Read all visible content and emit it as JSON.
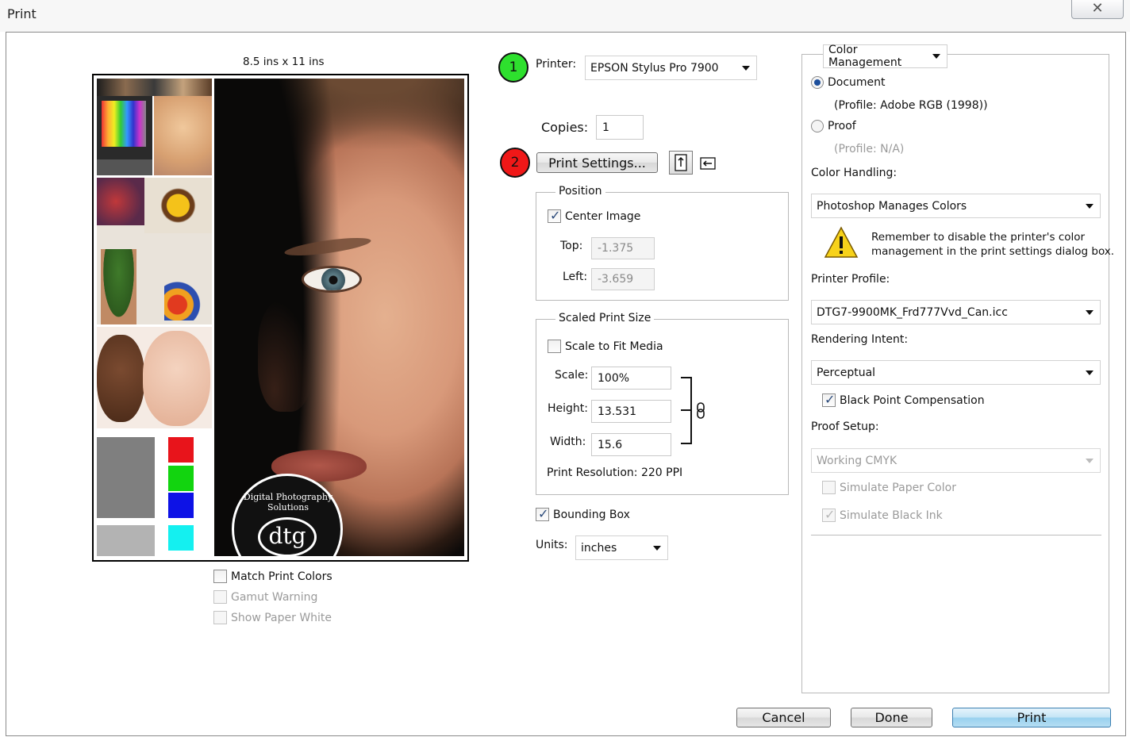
{
  "window": {
    "title": "Print",
    "close_glyph": "✕"
  },
  "preview": {
    "paper_size": "8.5 ins x 11 ins",
    "logo_text": "Digital Photography Solutions",
    "logo_mark": "dtg",
    "swatch_colors": [
      "#7f7f7f",
      "#e8141b",
      "#12d40f",
      "#0d12e6",
      "#b3b3b3",
      "#14f0f0"
    ],
    "match_print_colors": "Match Print Colors",
    "gamut_warning": "Gamut Warning",
    "show_paper_white": "Show Paper White"
  },
  "badges": {
    "one": "1",
    "two": "2",
    "one_color": "#2ee02e",
    "two_color": "#f01818"
  },
  "printer": {
    "label": "Printer:",
    "value": "EPSON Stylus Pro 7900"
  },
  "copies": {
    "label": "Copies:",
    "value": "1"
  },
  "print_settings_button": "Print Settings...",
  "position": {
    "title": "Position",
    "center_image": "Center Image",
    "top_label": "Top:",
    "top_value": "-1.375",
    "left_label": "Left:",
    "left_value": "-3.659"
  },
  "scaled": {
    "title": "Scaled Print Size",
    "scale_to_fit": "Scale to Fit Media",
    "scale_label": "Scale:",
    "scale_value": "100%",
    "height_label": "Height:",
    "height_value": "13.531",
    "width_label": "Width:",
    "width_value": "15.6",
    "resolution": "Print Resolution: 220 PPI"
  },
  "bounding_box": "Bounding Box",
  "units": {
    "label": "Units:",
    "value": "inches"
  },
  "color_mgmt": {
    "dropdown": "Color Management",
    "document": "Document",
    "document_profile": "(Profile: Adobe RGB (1998))",
    "proof": "Proof",
    "proof_profile": "(Profile: N/A)",
    "color_handling_label": "Color Handling:",
    "color_handling_value": "Photoshop Manages Colors",
    "warning_line1": "Remember to disable the printer's color",
    "warning_line2": "management in the print settings dialog box.",
    "printer_profile_label": "Printer Profile:",
    "printer_profile_value": "DTG7-9900MK_Frd777Vvd_Can.icc",
    "rendering_intent_label": "Rendering Intent:",
    "rendering_intent_value": "Perceptual",
    "black_point": "Black Point Compensation",
    "proof_setup_label": "Proof Setup:",
    "proof_setup_value": "Working CMYK",
    "simulate_paper": "Simulate Paper Color",
    "simulate_black": "Simulate Black Ink"
  },
  "buttons": {
    "cancel": "Cancel",
    "done": "Done",
    "print": "Print"
  }
}
